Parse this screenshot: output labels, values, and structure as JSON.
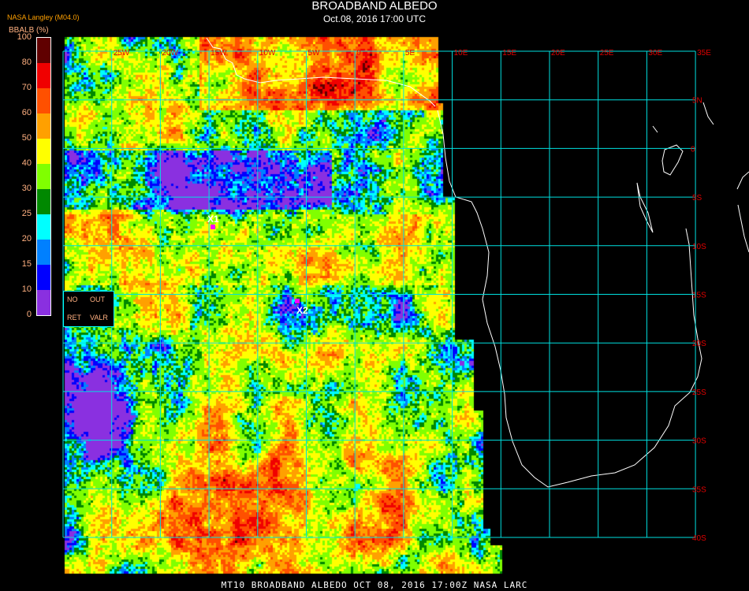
{
  "header": {
    "title": "BROADBAND ALBEDO",
    "subtitle": "Oct.08, 2016 17:00 UTC",
    "source": "NASA Langley (M04.0)"
  },
  "legend": {
    "unit": "BBALB (%)",
    "ticks": [
      "100",
      "80",
      "70",
      "60",
      "50",
      "40",
      "30",
      "25",
      "20",
      "15",
      "10",
      "0"
    ],
    "colors": [
      "#600000",
      "#f00000",
      "#ff5000",
      "#ffa000",
      "#ffff00",
      "#80ff00",
      "#008800",
      "#00ffff",
      "#0080ff",
      "#0000ff",
      "#8a30e0"
    ]
  },
  "status_box": {
    "no": "NO",
    "out": "OUT",
    "ret": "RET",
    "valr": "VALR"
  },
  "grid": {
    "color": "#00e0e0",
    "lon_labels": [
      "25W",
      "20W",
      "15W",
      "10W",
      "5W",
      "0",
      "5E",
      "10E",
      "15E",
      "20E",
      "25E",
      "30E",
      "35E"
    ],
    "lat_labels": [
      "5N",
      "0",
      "5S",
      "10S",
      "15S",
      "20S",
      "25S",
      "30S",
      "35S",
      "40S"
    ]
  },
  "markers": [
    {
      "label": "X1",
      "color": "#ff00ff"
    },
    {
      "label": "X2",
      "color": "#ff00ff"
    }
  ],
  "footer": "MT10  BROADBAND ALBEDO   OCT 08, 2016 17:00Z   NASA LARC"
}
